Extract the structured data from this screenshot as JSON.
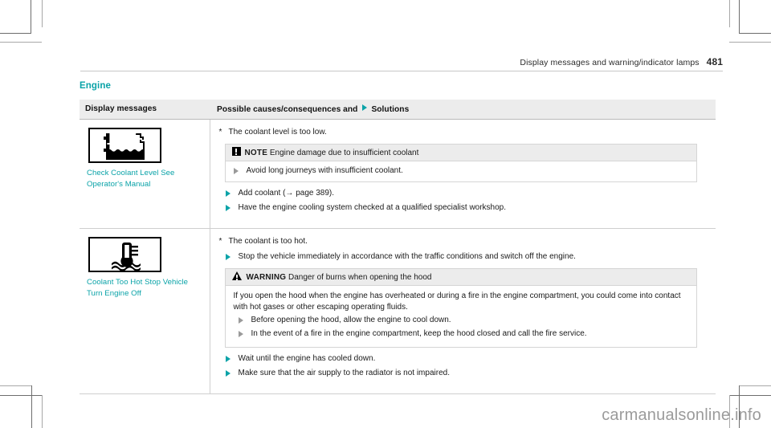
{
  "header": {
    "running_title": "Display messages and warning/indicator lamps",
    "page_number": "481"
  },
  "section": {
    "title": "Engine"
  },
  "accent_color": "#0aa3a8",
  "table": {
    "columns": [
      {
        "label": "Display messages"
      },
      {
        "label": "Possible causes/consequences and",
        "label_suffix": "Solutions"
      }
    ],
    "rows": [
      {
        "symbol": "coolant-reservoir-icon",
        "message": "Check Coolant Level See Operator's Manual",
        "cause": "The coolant level is too low.",
        "admonition": {
          "kind": "NOTE",
          "icon": "note-square-icon",
          "heading": "Engine damage due to insufficient coolant",
          "body": [],
          "steps": [
            "Avoid long journeys with insufficient coolant."
          ]
        },
        "steps": [
          "Add coolant (→ page 389).",
          "Have the engine cooling system checked at a qualified specialist workshop."
        ]
      },
      {
        "symbol": "coolant-temperature-icon",
        "message": "Coolant Too Hot Stop Vehicle Turn Engine Off",
        "cause": "The coolant is too hot.",
        "steps_before": [
          "Stop the vehicle immediately in accordance with the traffic conditions and switch off the engine."
        ],
        "admonition": {
          "kind": "WARNING",
          "icon": "warning-triangle-icon",
          "heading": "Danger of burns when opening the hood",
          "body": [
            "If you open the hood when the engine has overheated or during a fire in the engine compartment, you could come into contact with hot gases or other escaping operating fluids."
          ],
          "steps": [
            "Before opening the hood, allow the engine to cool down.",
            "In the event of a fire in the engine compartment, keep the hood closed and call the fire service."
          ]
        },
        "steps": [
          "Wait until the engine has cooled down.",
          "Make sure that the air supply to the radiator is not impaired."
        ]
      }
    ]
  },
  "watermark": {
    "text": "carmanualsonline.info"
  }
}
